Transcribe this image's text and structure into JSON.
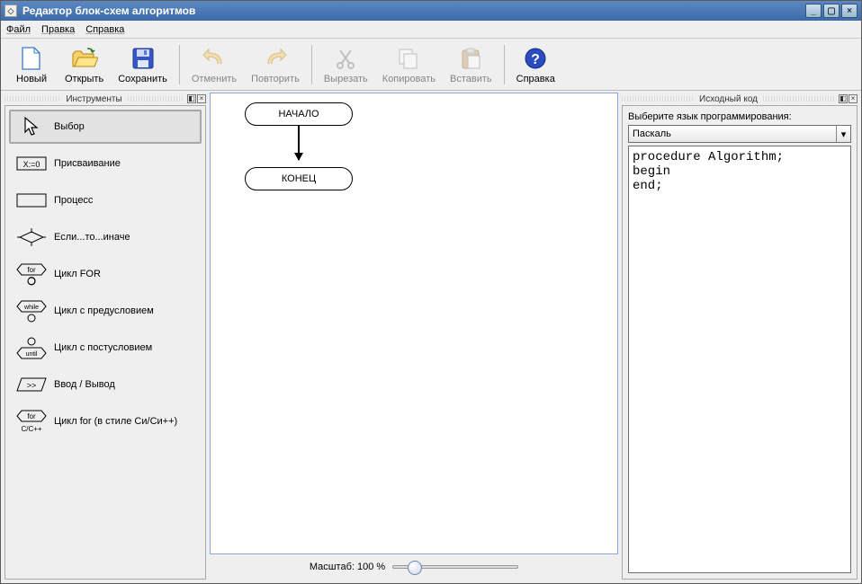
{
  "window": {
    "title": "Редактор блок-схем алгоритмов"
  },
  "menu": {
    "file": "Файл",
    "edit": "Правка",
    "help": "Справка"
  },
  "toolbar": {
    "new": "Новый",
    "open": "Открыть",
    "save": "Сохранить",
    "undo": "Отменить",
    "redo": "Повторить",
    "cut": "Вырезать",
    "copy": "Копировать",
    "paste": "Вставить",
    "help": "Справка"
  },
  "panels": {
    "tools_title": "Инструменты",
    "code_title": "Исходный код"
  },
  "tools": {
    "select": "Выбор",
    "assign": "Присваивание",
    "process": "Процесс",
    "ifelse": "Если...то...иначе",
    "for": "Цикл FOR",
    "while": "Цикл с предусловием",
    "until": "Цикл с постусловием",
    "io": "Ввод / Вывод",
    "forcc": "Цикл for (в стиле Си/Си++)"
  },
  "flowchart": {
    "start": "НАЧАЛО",
    "end": "КОНЕЦ"
  },
  "zoom": {
    "label": "Масштаб: 100 %"
  },
  "code": {
    "choose_lang_label": "Выберите язык программирования:",
    "language_selected": "Паскаль",
    "source": "procedure Algorithm;\nbegin\nend;"
  }
}
